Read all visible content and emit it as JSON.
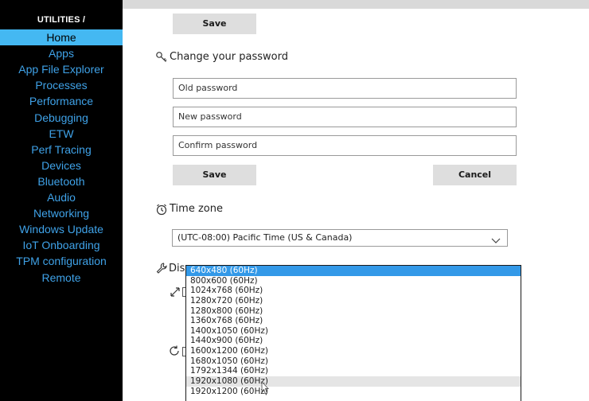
{
  "sidebar": {
    "heading": "UTILITIES /",
    "items": [
      {
        "label": "Home"
      },
      {
        "label": "Apps"
      },
      {
        "label": "App File Explorer"
      },
      {
        "label": "Processes"
      },
      {
        "label": "Performance"
      },
      {
        "label": "Debugging"
      },
      {
        "label": "ETW"
      },
      {
        "label": "Perf Tracing"
      },
      {
        "label": "Devices"
      },
      {
        "label": "Bluetooth"
      },
      {
        "label": "Audio"
      },
      {
        "label": "Networking"
      },
      {
        "label": "Windows Update"
      },
      {
        "label": "IoT Onboarding"
      },
      {
        "label": "TPM configuration"
      },
      {
        "label": "Remote"
      }
    ],
    "active_index": 0
  },
  "top_section": {
    "save_label": "Save"
  },
  "password": {
    "heading": "Change your password",
    "icon": "key-icon",
    "old_placeholder": "Old password",
    "new_placeholder": "New password",
    "confirm_placeholder": "Confirm password",
    "save_label": "Save",
    "cancel_label": "Cancel"
  },
  "timezone": {
    "heading": "Time zone",
    "icon": "clock-icon",
    "selected": "(UTC-08:00) Pacific Time (US & Canada)"
  },
  "display": {
    "heading_partial": "Disp",
    "icon": "wrench-icon"
  },
  "resolution_dropdown": {
    "options": [
      "640x480 (60Hz)",
      "800x600 (60Hz)",
      "1024x768 (60Hz)",
      "1280x720 (60Hz)",
      "1280x800 (60Hz)",
      "1360x768 (60Hz)",
      "1400x1050 (60Hz)",
      "1440x900 (60Hz)",
      "1600x1200 (60Hz)",
      "1680x1050 (60Hz)",
      "1792x1344 (60Hz)",
      "1920x1080 (60Hz)",
      "1920x1200 (60Hz)"
    ],
    "selected_index": 0,
    "hover_index": 11
  },
  "colors": {
    "sidebar_bg": "#000000",
    "sidebar_link": "#3fa2e8",
    "sidebar_active_bg": "#44b8f2",
    "selected_option_bg": "#3399e8"
  }
}
